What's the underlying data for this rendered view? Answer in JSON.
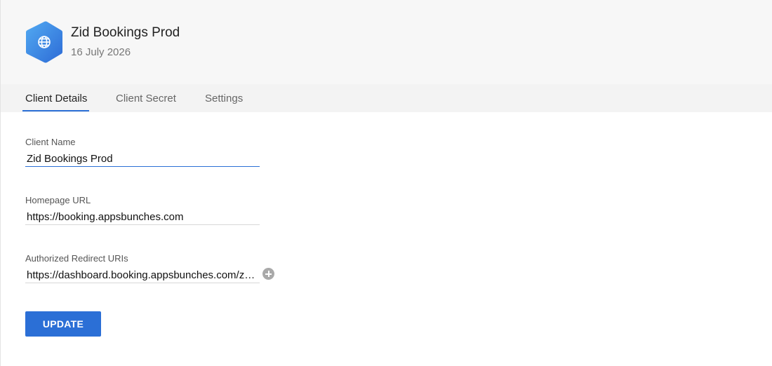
{
  "app": {
    "name": "Zid Bookings Prod",
    "date": "16 July 2026",
    "icon": "globe-icon",
    "icon_gradient": [
      "#4aa3f0",
      "#2f6fd8"
    ]
  },
  "tabs": [
    {
      "label": "Client Details",
      "active": true
    },
    {
      "label": "Client Secret",
      "active": false
    },
    {
      "label": "Settings",
      "active": false
    }
  ],
  "form": {
    "client_name": {
      "label": "Client Name",
      "value": "Zid Bookings Prod"
    },
    "homepage_url": {
      "label": "Homepage URL",
      "value": "https://booking.appsbunches.com"
    },
    "redirect_uris": {
      "label": "Authorized Redirect URIs",
      "value": "https://dashboard.booking.appsbunches.com/z…"
    },
    "update_label": "UPDATE"
  },
  "colors": {
    "accent": "#2b6fd6",
    "header_bg": "#f7f7f7",
    "tabs_bg": "#f3f3f3"
  }
}
